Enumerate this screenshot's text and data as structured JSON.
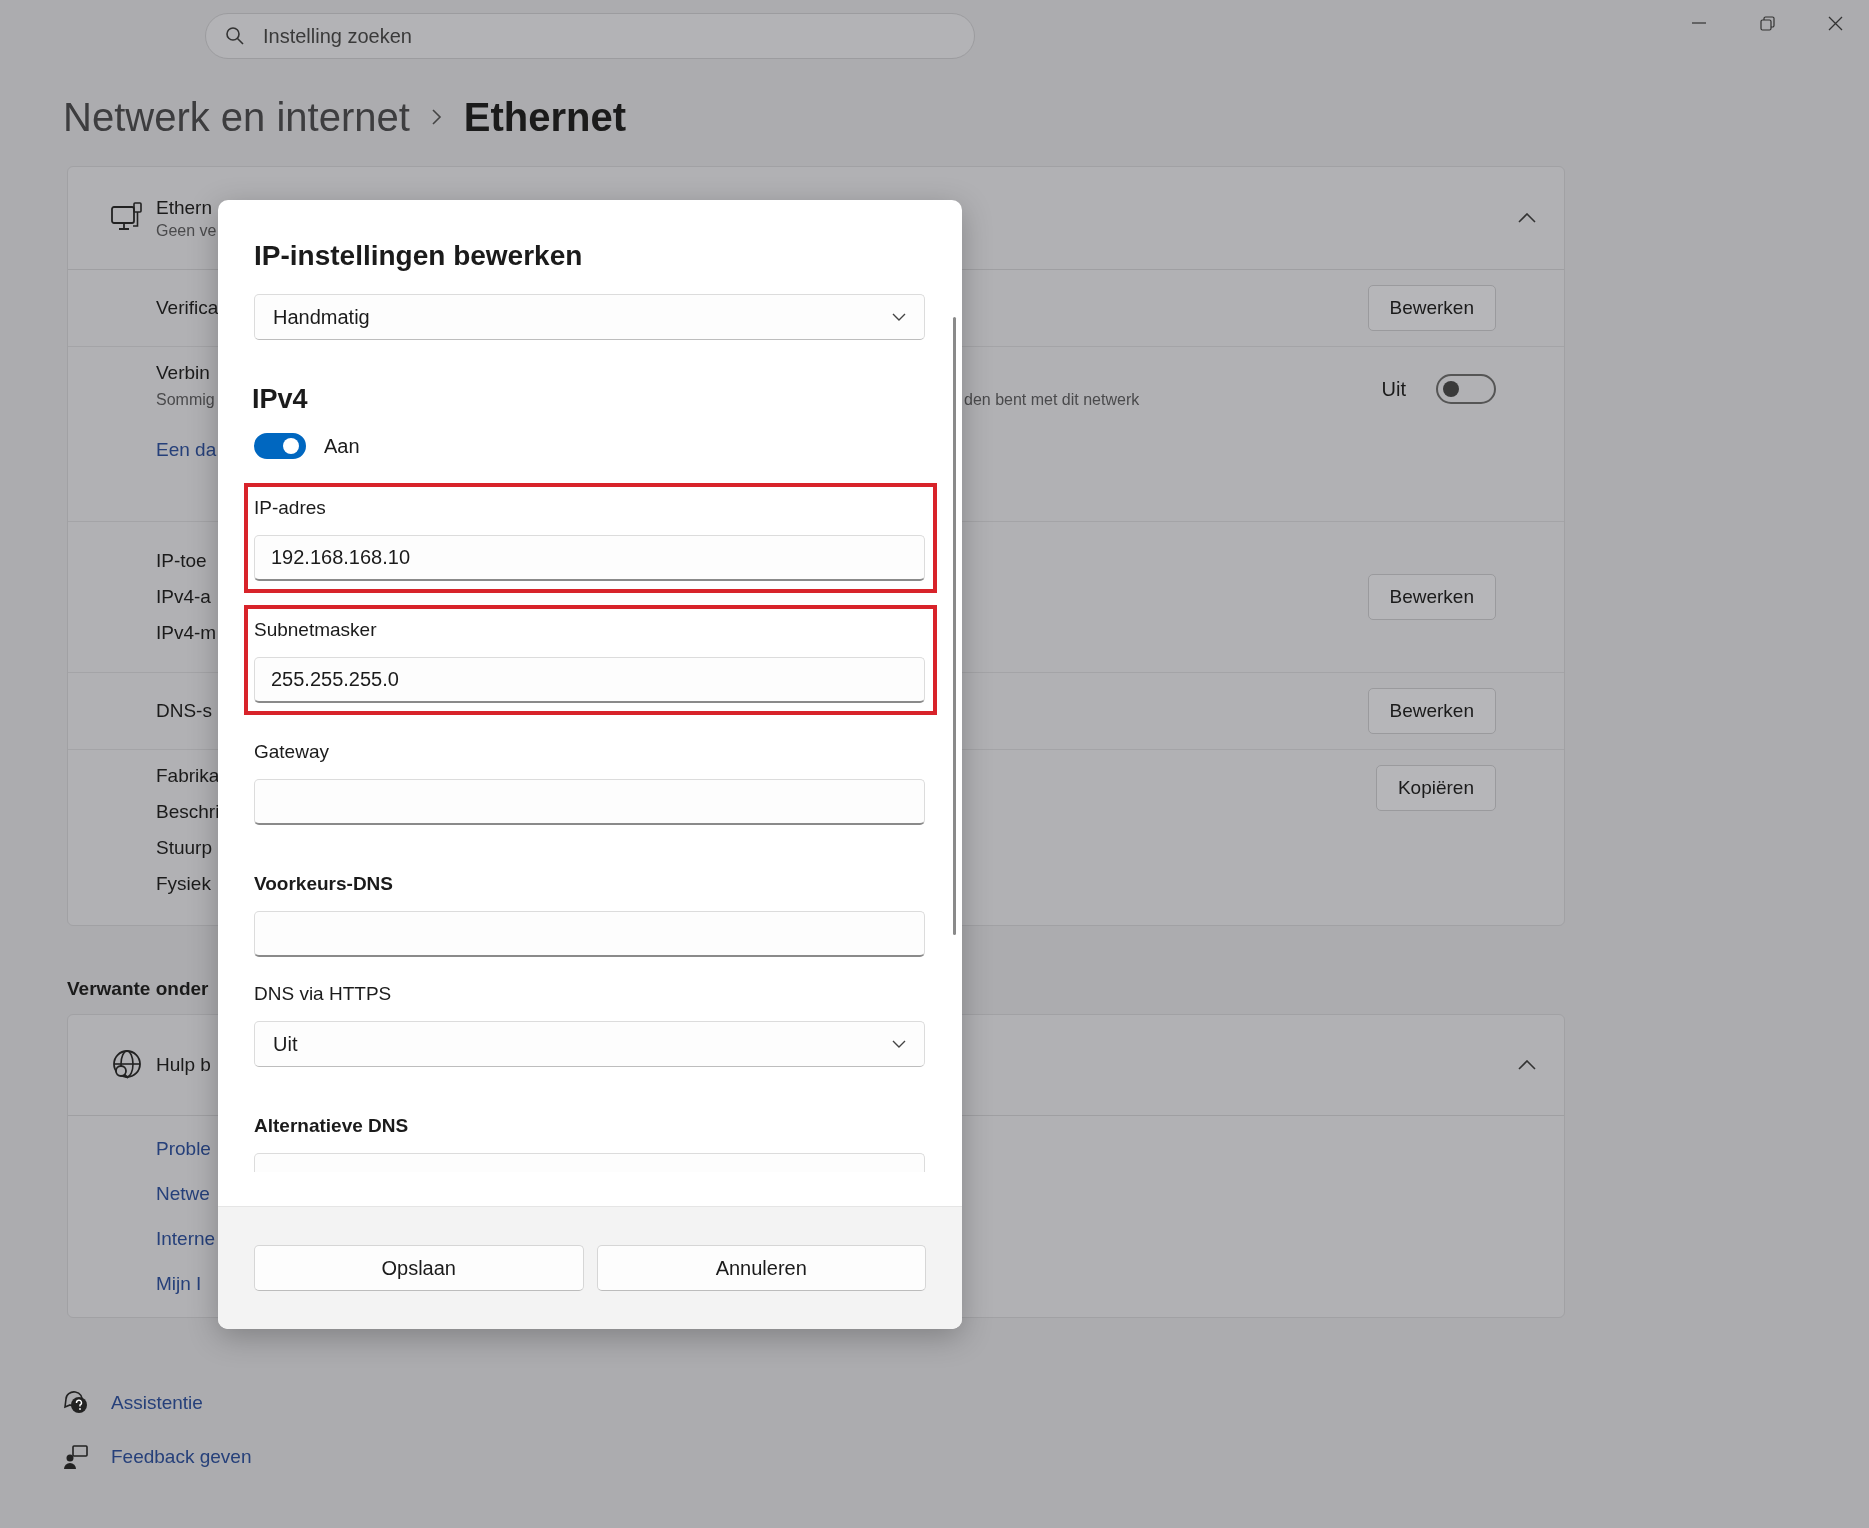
{
  "search": {
    "placeholder": "Instelling zoeken"
  },
  "breadcrumb": [
    "Netwerk en internet",
    "Ethernet"
  ],
  "ethernet_card": {
    "title": "Ethern",
    "subtitle": "Geen ve",
    "expanded": true,
    "rows": [
      {
        "kind": "edit",
        "lines": [
          "Verifica"
        ],
        "button": "Bewerken"
      },
      {
        "kind": "toggle",
        "title": "Verbin",
        "subtitle": "Sommig",
        "subtitle_rest": "den bent met dit netwerk",
        "toggle_label": "Uit",
        "on": false,
        "link": "Een da"
      },
      {
        "kind": "edit",
        "lines": [
          "IP-toe",
          "IPv4-a",
          "IPv4-m"
        ],
        "button": "Bewerken"
      },
      {
        "kind": "edit",
        "lines": [
          "DNS-s"
        ],
        "button": "Bewerken"
      },
      {
        "kind": "copy",
        "lines": [
          "Fabrika",
          "Beschri",
          "Stuurp",
          "Fysiek"
        ],
        "button": "Kopiëren"
      }
    ]
  },
  "related": {
    "heading": "Verwante onder",
    "title": "Hulp b",
    "expanded": true,
    "links": [
      "Proble",
      "Netwe",
      "Interne",
      "Mijn I"
    ]
  },
  "footer_links": [
    {
      "kind": "assist",
      "label": "Assistentie"
    },
    {
      "kind": "feedback",
      "label": "Feedback geven"
    }
  ],
  "dialog": {
    "title": "IP-instellingen bewerken",
    "mode": "Handmatig",
    "section": "IPv4",
    "ipv4_toggle": {
      "on": true,
      "label": "Aan"
    },
    "fields": [
      {
        "kind": "input",
        "label": "IP-adres",
        "value": "192.168.168.10",
        "highlighted": true
      },
      {
        "kind": "input",
        "label": "Subnetmasker",
        "value": "255.255.255.0",
        "highlighted": true
      },
      {
        "kind": "input",
        "label": "Gateway",
        "highlighted": false
      },
      {
        "kind": "group-input",
        "label": "Voorkeurs-DNS",
        "highlighted": false
      },
      {
        "kind": "select",
        "label": "DNS via HTTPS",
        "value": "Uit",
        "highlighted": false
      },
      {
        "kind": "group-input",
        "label": "Alternatieve DNS",
        "highlighted": false
      }
    ],
    "buttons": [
      "Opslaan",
      "Annuleren"
    ]
  }
}
